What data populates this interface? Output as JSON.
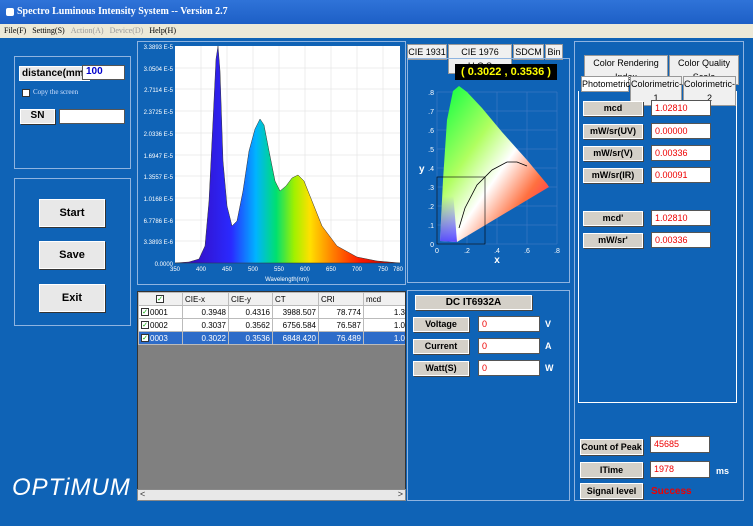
{
  "app": {
    "title": "Spectro Luminous Intensity System -- Version 2.7"
  },
  "menu": [
    "File(F)",
    "Setting(S)",
    "Action(A)",
    "Device(D)",
    "Help(H)"
  ],
  "left": {
    "distance_label": "distance(mm)",
    "distance_value": "100",
    "copy_label": "Copy the screen",
    "sn_label": "SN",
    "sn_value": "",
    "start": "Start",
    "save": "Save",
    "exit": "Exit",
    "logo": "OPTiMUM"
  },
  "spectrum": {
    "y_ticks": [
      "3.3893 E-5",
      "3.0504 E-5",
      "2.7114 E-5",
      "2.3725 E-5",
      "2.0336 E-5",
      "1.6947 E-5",
      "1.3557 E-5",
      "1.0168 E-5",
      "6.7786 E-6",
      "3.3893 E-6",
      "0.0000"
    ],
    "x_ticks": [
      "350",
      "400",
      "450",
      "500",
      "550",
      "600",
      "650",
      "700",
      "750",
      "780"
    ],
    "xlabel": "Wavelength(nm)"
  },
  "cie": {
    "tabs": [
      "CIE 1931",
      "CIE 1976 U.C.S",
      "SDCM",
      "Bin"
    ],
    "coord": "( 0.3022 , 0.3536 )",
    "ylabel": "y",
    "xlabel": "x",
    "y_ticks": [
      ".8",
      ".7",
      ".6",
      ".5",
      ".4",
      ".3",
      ".2",
      ".1",
      "0"
    ],
    "x_ticks": [
      "0",
      ".2",
      ".4",
      ".6",
      ".8"
    ]
  },
  "table": {
    "headers": [
      "",
      "CIE-x",
      "CIE-y",
      "CT",
      "CRI",
      "mcd"
    ],
    "rows": [
      {
        "id": "0001",
        "x": "0.3948",
        "y": "0.4316",
        "ct": "3988.507",
        "cri": "78.774",
        "mcd": "1.3"
      },
      {
        "id": "0002",
        "x": "0.3037",
        "y": "0.3562",
        "ct": "6756.584",
        "cri": "76.587",
        "mcd": "1.0"
      },
      {
        "id": "0003",
        "x": "0.3022",
        "y": "0.3536",
        "ct": "6848.420",
        "cri": "76.489",
        "mcd": "1.0"
      }
    ]
  },
  "dc": {
    "title": "DC IT6932A",
    "voltage_label": "Voltage",
    "voltage": "0",
    "voltage_unit": "V",
    "current_label": "Current",
    "current": "0",
    "current_unit": "A",
    "watt_label": "Watt(S)",
    "watt": "0",
    "watt_unit": "W"
  },
  "right": {
    "tabs_top": [
      "Color Rendering Index",
      "Color Quality Scale"
    ],
    "tabs_bottom": [
      "Photometric",
      "Colorimetric-1",
      "Colorimetric-2"
    ],
    "rows": [
      {
        "label": "mcd",
        "value": "1.02810"
      },
      {
        "label": "mW/sr(UV)",
        "value": "0.00000"
      },
      {
        "label": "mW/sr(V)",
        "value": "0.00336"
      },
      {
        "label": "mW/sr(IR)",
        "value": "0.00091"
      },
      {
        "label": "mcd'",
        "value": "1.02810"
      },
      {
        "label": "mW/sr'",
        "value": "0.00336"
      }
    ],
    "peak_label": "Count of Peak",
    "peak": "45685",
    "itime_label": "ITime",
    "itime": "1978",
    "itime_unit": "ms",
    "signal_label": "Signal level",
    "signal": "Success"
  }
}
